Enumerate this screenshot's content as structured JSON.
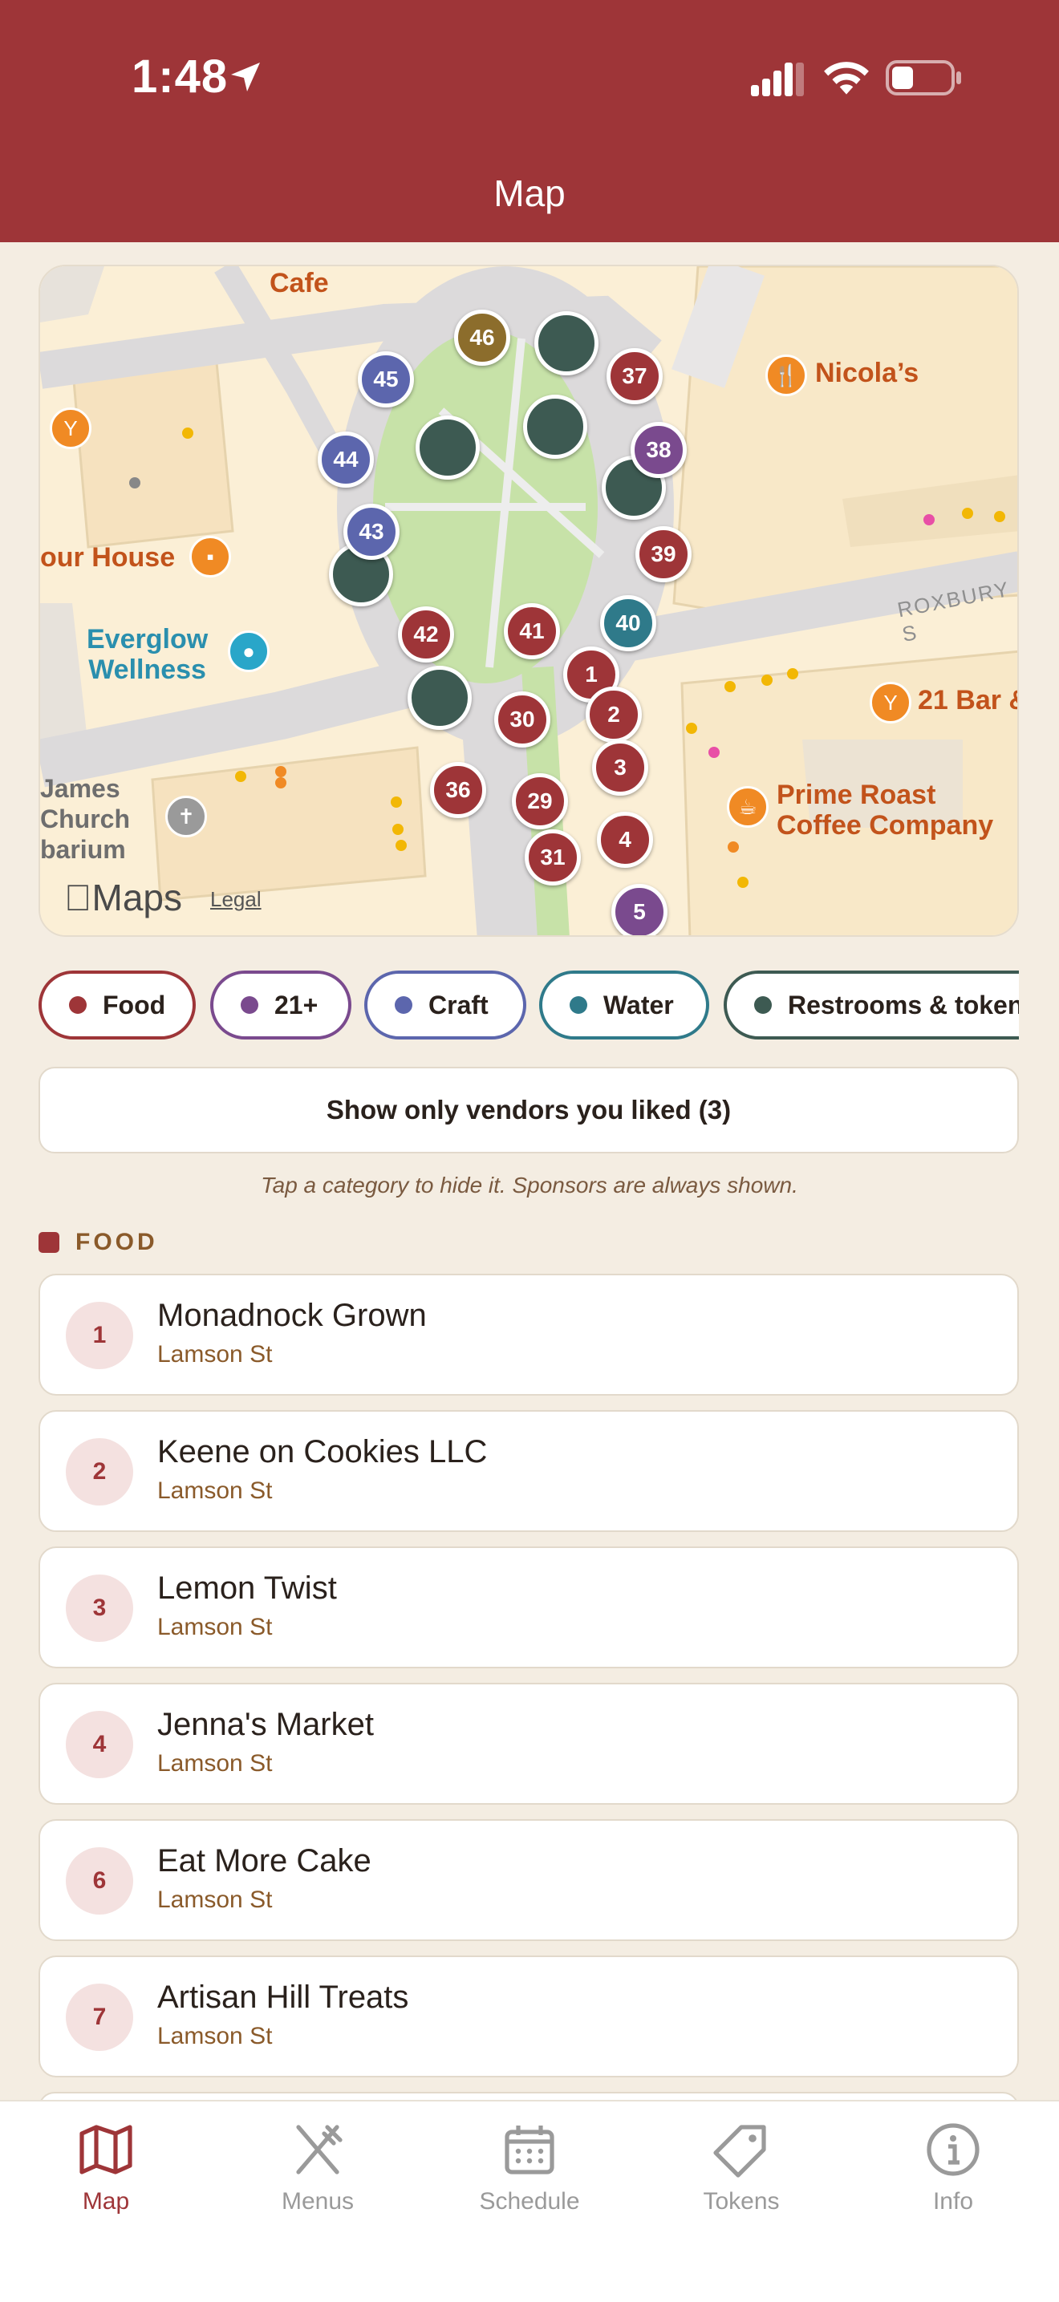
{
  "status_bar": {
    "time": "1:48"
  },
  "header": {
    "title": "Map"
  },
  "map": {
    "pois": {
      "cafe": "Cafe",
      "nicolas": "Nicola’s",
      "our_house": "our House",
      "everglow": "Everglow\nWellness",
      "bar21": "21 Bar &",
      "prime_roast": "Prime Roast\nCoffee Company",
      "james_church": "James\nChurch\nbarium"
    },
    "street": "ROXBURY S",
    "maps_logo": "Maps",
    "legal": "Legal",
    "pins": [
      {
        "label": "46",
        "color": "#8c6d2c"
      },
      {
        "label": "45",
        "color": "#5c66ad"
      },
      {
        "label": "37",
        "color": "#9e3538"
      },
      {
        "label": "38",
        "color": "#7a4a8e"
      },
      {
        "label": "44",
        "color": "#5c66ad"
      },
      {
        "label": "43",
        "color": "#5c66ad"
      },
      {
        "label": "39",
        "color": "#9e3538"
      },
      {
        "label": "40",
        "color": "#2f7a8a"
      },
      {
        "label": "42",
        "color": "#9e3538"
      },
      {
        "label": "41",
        "color": "#9e3538"
      },
      {
        "label": "1",
        "color": "#9e3538"
      },
      {
        "label": "2",
        "color": "#9e3538"
      },
      {
        "label": "30",
        "color": "#9e3538"
      },
      {
        "label": "3",
        "color": "#9e3538"
      },
      {
        "label": "36",
        "color": "#9e3538"
      },
      {
        "label": "29",
        "color": "#9e3538"
      },
      {
        "label": "4",
        "color": "#9e3538"
      },
      {
        "label": "31",
        "color": "#9e3538"
      },
      {
        "label": "5",
        "color": "#7a4a8e"
      }
    ]
  },
  "filters": [
    {
      "label": "Food",
      "color": "#9e3538"
    },
    {
      "label": "21+",
      "color": "#7a4a8e"
    },
    {
      "label": "Craft",
      "color": "#5c66ad"
    },
    {
      "label": "Water",
      "color": "#2f7a8a"
    },
    {
      "label": "Restrooms & tokens",
      "color": "#3d5a52"
    }
  ],
  "liked_button": "Show only vendors you liked (3)",
  "hint": "Tap a category to hide it. Sponsors are always shown.",
  "section": {
    "title": "FOOD"
  },
  "vendors": [
    {
      "num": "1",
      "name": "Monadnock Grown",
      "location": "Lamson St"
    },
    {
      "num": "2",
      "name": "Keene on Cookies LLC",
      "location": "Lamson St"
    },
    {
      "num": "3",
      "name": "Lemon Twist",
      "location": "Lamson St"
    },
    {
      "num": "4",
      "name": "Jenna's Market",
      "location": "Lamson St"
    },
    {
      "num": "6",
      "name": "Eat More Cake",
      "location": "Lamson St"
    },
    {
      "num": "7",
      "name": "Artisan Hill Treats",
      "location": "Lamson St"
    }
  ],
  "tabs": [
    {
      "label": "Map",
      "icon": "map-icon"
    },
    {
      "label": "Menus",
      "icon": "utensils-icon"
    },
    {
      "label": "Schedule",
      "icon": "calendar-icon"
    },
    {
      "label": "Tokens",
      "icon": "tag-icon"
    },
    {
      "label": "Info",
      "icon": "info-icon"
    }
  ]
}
